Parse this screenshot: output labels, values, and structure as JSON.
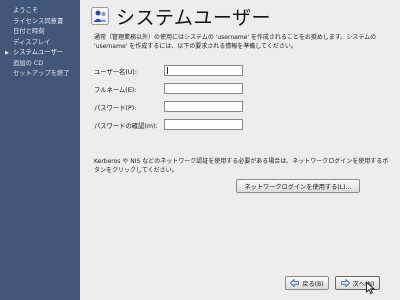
{
  "sidebar": {
    "items": [
      {
        "label": "ようこそ",
        "active": false
      },
      {
        "label": "ライセンス同意書",
        "active": false
      },
      {
        "label": "日付と時刻",
        "active": false
      },
      {
        "label": "ディスプレイ",
        "active": false
      },
      {
        "label": "システムユーザー",
        "active": true
      },
      {
        "label": "追加の CD",
        "active": false
      },
      {
        "label": "セットアップを終了",
        "active": false
      }
    ],
    "active_arrow": "▶"
  },
  "header": {
    "title": "システムユーザー",
    "icon": "users-icon"
  },
  "description": "通常（管理業務以外）の使用にはシステムの 'username' を作成されることをお奨めします。システムの 'username' を作成するには、以下の要求される情報を準備してください。",
  "form": {
    "username_label": "ユーザー名(U):",
    "fullname_label": "フルネーム(E):",
    "password_label": "パスワード(P):",
    "confirm_label": "パスワードの確認(m):",
    "username_value": "",
    "fullname_value": "",
    "password_value": "",
    "confirm_value": ""
  },
  "network": {
    "text": "Kerberos や NIS などのネットワーク認証を使用する必要がある場合は、ネットワークログインを使用するボタンをクリックしてください。",
    "button_label": "ネットワークログインを使用する(L)..."
  },
  "nav": {
    "back_label": "戻る(B)",
    "next_label": "次へ(N)",
    "back_icon": "back-arrow-icon",
    "next_icon": "forward-arrow-icon"
  },
  "colors": {
    "sidebar_bg": "#44557a",
    "main_bg": "#ededed",
    "accent": "#2a4fa8"
  }
}
